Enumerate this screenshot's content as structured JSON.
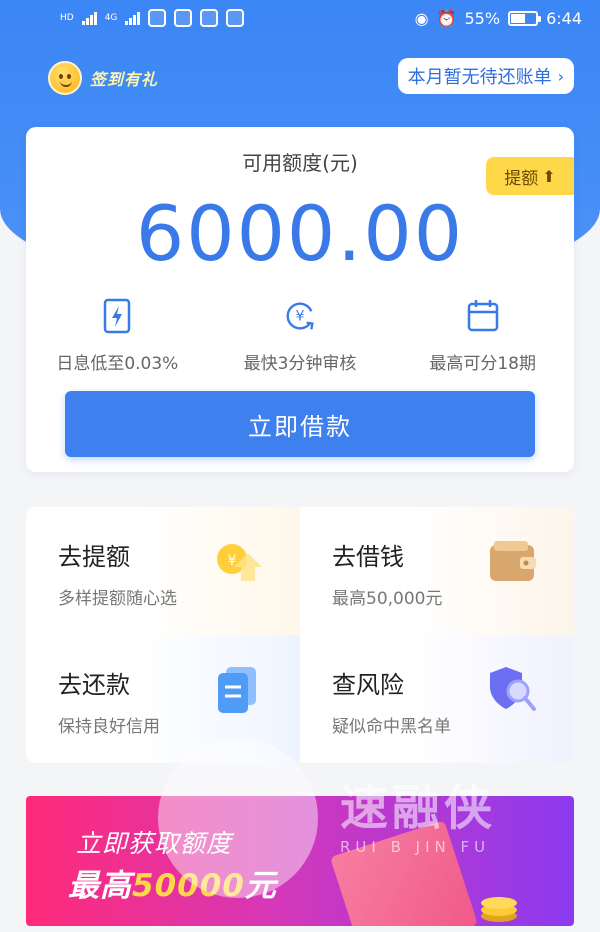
{
  "status_bar": {
    "network_1": "HD",
    "network_2": "4G",
    "network_3": "4G",
    "battery": "55%",
    "time": "6:44"
  },
  "header": {
    "checkin_label": "签到有礼",
    "bill_status": "本月暂无待还账单"
  },
  "credit": {
    "label": "可用额度(元)",
    "amount": "6000.00",
    "raise_label": "提额",
    "features": [
      {
        "icon": "lightning-card-icon",
        "text": "日息低至0.03%"
      },
      {
        "icon": "yuan-refresh-icon",
        "text": "最快3分钟审核"
      },
      {
        "icon": "calendar-icon",
        "text": "最高可分18期"
      }
    ],
    "borrow_button": "立即借款"
  },
  "actions": [
    {
      "title": "去提额",
      "subtitle": "多样提额随心选",
      "icon": "coin-up-icon"
    },
    {
      "title": "去借钱",
      "subtitle": "最高50,000元",
      "icon": "wallet-icon"
    },
    {
      "title": "去还款",
      "subtitle": "保持良好信用",
      "icon": "document-icon"
    },
    {
      "title": "查风险",
      "subtitle": "疑似命中黑名单",
      "icon": "shield-search-icon"
    }
  ],
  "banner": {
    "line1": "立即获取额度",
    "line2_prefix": "最高",
    "line2_amount": "50000",
    "line2_suffix": "元"
  },
  "watermark": {
    "text": "速融侠",
    "sub": "RUI B    JIN FU"
  },
  "colors": {
    "primary": "#3f80ef",
    "hero": "#3b86f5",
    "badge": "#ffd84a"
  }
}
